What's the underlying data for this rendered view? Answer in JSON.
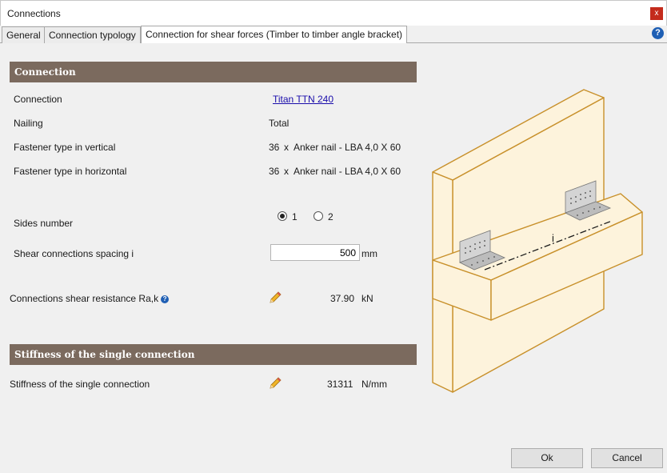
{
  "window": {
    "title": "Connections",
    "close_glyph": "x"
  },
  "tabs": [
    {
      "label": "General"
    },
    {
      "label": "Connection typology"
    },
    {
      "label": "Connection for shear forces (Timber to timber angle bracket)"
    }
  ],
  "help_glyph": "?",
  "connection_section": {
    "header": "Connection",
    "rows": {
      "connection_label": "Connection",
      "connection_value": "Titan TTN 240",
      "nailing_label": "Nailing",
      "nailing_value": "Total",
      "vertical_label": "Fastener type in vertical",
      "vertical_count": "36",
      "vertical_x": "x",
      "vertical_value": "Anker nail - LBA 4,0 X 60",
      "horizontal_label": "Fastener type in horizontal",
      "horizontal_count": "36",
      "horizontal_x": "x",
      "horizontal_value": "Anker nail - LBA 4,0 X 60",
      "sides_label": "Sides number",
      "sides_option_1": "1",
      "sides_option_2": "2",
      "spacing_label": "Shear connections spacing i",
      "spacing_value": "500",
      "spacing_unit": "mm",
      "resistance_label": "Connections shear resistance Ra,k",
      "resistance_value": "37.90",
      "resistance_unit": "kN"
    }
  },
  "stiffness_section": {
    "header": "Stiffness of the single connection",
    "label": "Stiffness of the single connection",
    "value": "31311",
    "unit": "N/mm"
  },
  "drawing": {
    "dimension_label": "i"
  },
  "buttons": {
    "ok": "Ok",
    "cancel": "Cancel"
  },
  "colors": {
    "section_header": "#7b6a5e",
    "timber_outline": "#c8902a",
    "timber_fill": "#fdf3dc"
  }
}
